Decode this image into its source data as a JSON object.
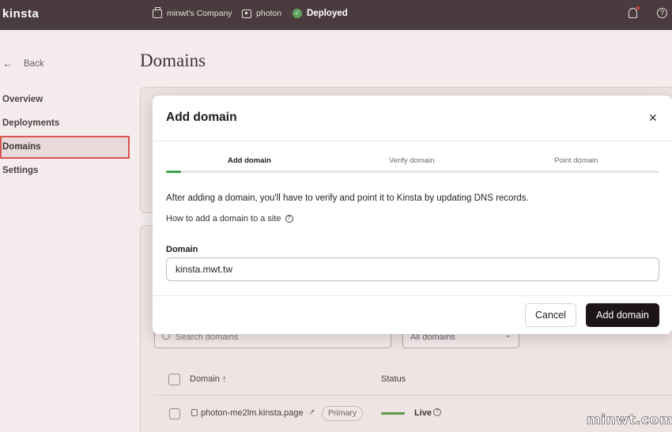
{
  "topbar": {
    "logo": "kinsta",
    "company": "minwt's Company",
    "site": "photon",
    "status": "Deployed",
    "icons": [
      "briefcase-icon",
      "site-icon",
      "check-circle-icon",
      "bell-icon",
      "help-icon"
    ]
  },
  "sidebar": {
    "back_label": "Back",
    "items": [
      {
        "label": "Overview"
      },
      {
        "label": "Deployments"
      },
      {
        "label": "Domains",
        "active": true
      },
      {
        "label": "Settings"
      }
    ]
  },
  "main": {
    "title": "Domains",
    "search_placeholder": "Search domains",
    "filter_value": "All domains",
    "table": {
      "columns": [
        "Domain ↑",
        "Status"
      ],
      "rows": [
        {
          "domain": "photon-me2lm.kinsta.page",
          "badge": "Primary",
          "status": "Live"
        }
      ]
    }
  },
  "modal": {
    "title": "Add domain",
    "steps": [
      "Add domain",
      "Verify domain",
      "Point domain"
    ],
    "active_step": 0,
    "progress_fraction": 0.03,
    "description": "After adding a domain, you'll have to verify and point it to Kinsta by updating DNS records.",
    "help_link": "How to add a domain to a site",
    "field_label": "Domain",
    "field_value": "kinsta.mwt.tw",
    "cancel_label": "Cancel",
    "submit_label": "Add domain"
  },
  "colors": {
    "topbar": "#4a3c3e",
    "accent_green": "#3fa34d",
    "primary_button": "#1c1416",
    "highlight_border": "#d9534f"
  },
  "watermark": "minwt.com"
}
